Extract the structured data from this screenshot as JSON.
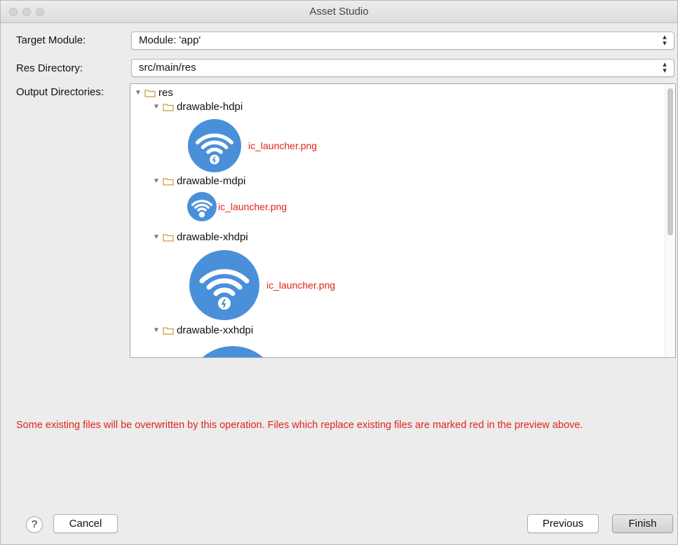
{
  "window": {
    "title": "Asset Studio"
  },
  "form": {
    "target_module": {
      "label": "Target Module:",
      "value": "Module: 'app'"
    },
    "res_directory": {
      "label": "Res Directory:",
      "value": "src/main/res"
    },
    "output_directories": {
      "label": "Output Directories:"
    }
  },
  "tree": {
    "root": "res",
    "folders": [
      {
        "name": "drawable-hdpi",
        "file": "ic_launcher.png"
      },
      {
        "name": "drawable-mdpi",
        "file": "ic_launcher.png"
      },
      {
        "name": "drawable-xhdpi",
        "file": "ic_launcher.png"
      },
      {
        "name": "drawable-xxhdpi"
      }
    ],
    "icon": "wifi-launcher-icon",
    "icon_color": "#4a90d9",
    "overwrite_color": "#e0241a"
  },
  "warning": "Some existing files will be overwritten by this operation. Files which replace existing files are marked red in the preview above.",
  "buttons": {
    "help": "?",
    "cancel": "Cancel",
    "previous": "Previous",
    "finish": "Finish"
  }
}
